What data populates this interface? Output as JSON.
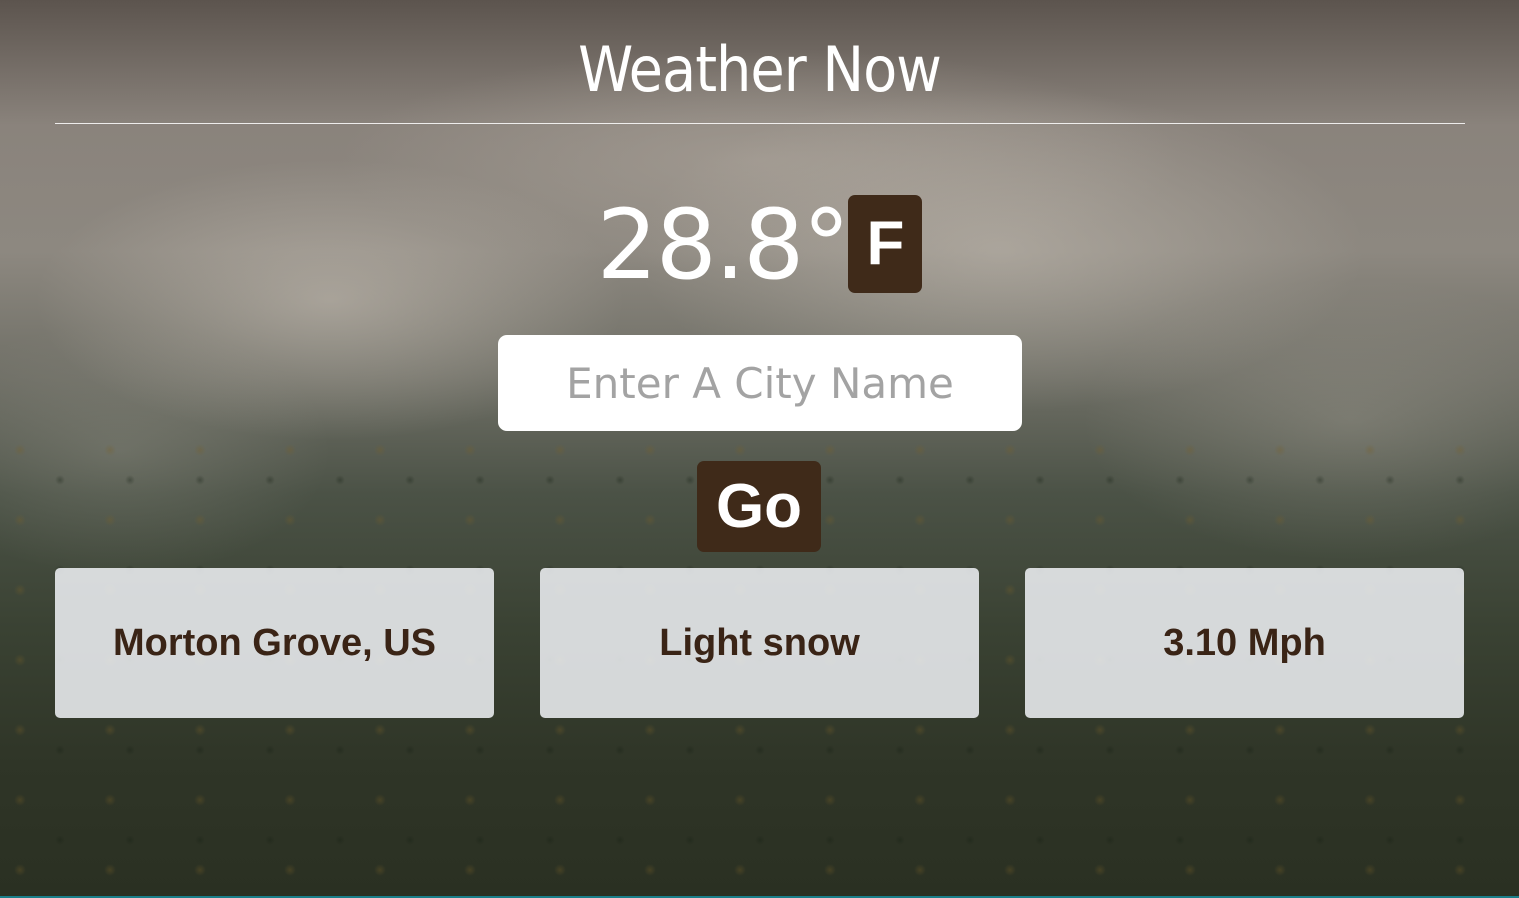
{
  "header": {
    "title": "Weather Now"
  },
  "temperature": {
    "value": "28.8°",
    "unit_button_label": "F"
  },
  "search": {
    "placeholder": "Enter A City Name",
    "value": "",
    "go_label": "Go"
  },
  "cards": {
    "location": "Morton Grove, US",
    "condition": "Light snow",
    "wind": "3.10 Mph"
  },
  "colors": {
    "button_bg": "#3f2a19",
    "card_text": "#3a2416",
    "card_bg": "#eceef1"
  }
}
